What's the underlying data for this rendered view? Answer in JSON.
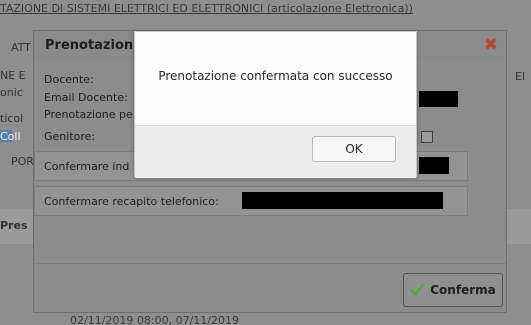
{
  "background": {
    "title": "TAZIONE DI SISTEMI ELETTRICI ED ELETTRONICI (articolazione Elettronica))",
    "fragments": [
      "ATT",
      "NE E",
      "onic",
      "ticol",
      "Coll",
      "POR",
      "El",
      "Pres"
    ],
    "bottom_text": "02/11/2019 08:00, 07/11/2019"
  },
  "main_modal": {
    "title": "Prenotazion",
    "close_symbol": "✖",
    "fields": {
      "docente": "Docente:",
      "email_docente": "Email Docente:",
      "prenotazione": "Prenotazione pe",
      "genitore": "Genitore:",
      "confermare_ind": "Confermare ind",
      "confermare_recapito": "Confermare recapito telefonico:"
    },
    "confirm_label": "Conferma",
    "colors": {
      "close": "#b34a2e",
      "check": "#4caf2e"
    },
    "icons": {
      "close": "close-icon",
      "confirm": "check-icon"
    }
  },
  "alert": {
    "message": "Prenotazione confermata con successo",
    "ok_label": "OK"
  }
}
